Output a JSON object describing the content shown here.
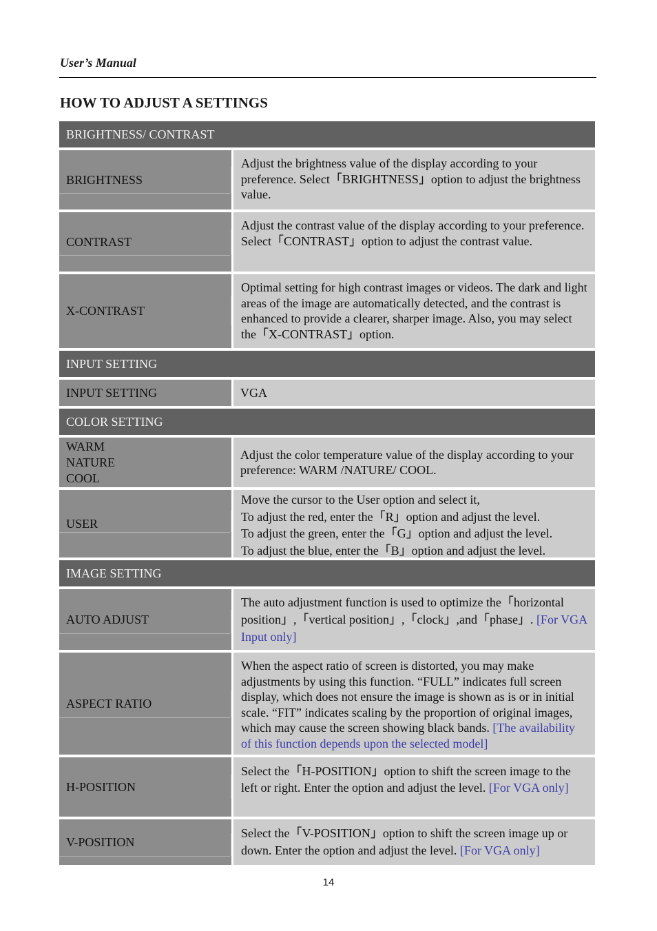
{
  "running_header": "User’s Manual",
  "page_title": "HOW TO ADJUST A SETTINGS",
  "page_number": "14",
  "colors": {
    "section_header_bg": "#616161",
    "label_cell_bg": "#8c8c8c",
    "description_cell_bg": "#cccccc",
    "note_text": "#3c3ca8"
  },
  "sections": [
    {
      "title": "BRIGHTNESS/ CONTRAST",
      "rows": [
        {
          "label": "BRIGHTNESS",
          "description": "Adjust the brightness value of the display according to your preference. Select「BRIGHTNESS」option to adjust the brightness value.",
          "note": ""
        },
        {
          "label": "CONTRAST",
          "description": "Adjust the contrast value of the display according to your preference. Select「CONTRAST」option to adjust the contrast value.",
          "note": ""
        },
        {
          "label": "X-CONTRAST",
          "description": "Optimal setting for high contrast images or videos. The dark and light areas of the image are automatically detected, and the contrast is enhanced to provide a clearer, sharper image. Also, you may select the「X-CONTRAST」option.",
          "note": ""
        }
      ]
    },
    {
      "title": "INPUT SETTING",
      "rows": [
        {
          "label": "INPUT SETTING",
          "description": "VGA",
          "note": ""
        }
      ]
    },
    {
      "title": "COLOR SETTING",
      "rows": [
        {
          "label_lines": [
            "WARM",
            "NATURE",
            "COOL"
          ],
          "description": "Adjust the color temperature value of the display according to your preference: WARM /NATURE/ COOL.",
          "note": ""
        },
        {
          "label": "USER",
          "description_lines": [
            "Move the cursor to the User option and select it,",
            "To adjust the red, enter the「R」option and adjust the level.",
            "To adjust the green, enter the「G」option and adjust the level.",
            "To adjust the blue, enter the「B」option and adjust the level."
          ],
          "note": ""
        }
      ]
    },
    {
      "title": "IMAGE SETTING",
      "rows": [
        {
          "label": "AUTO ADJUST",
          "description": "The auto adjustment function is used to optimize the「horizontal position」,「vertical position」,「clock」,and「phase」. ",
          "note": "[For VGA Input only]"
        },
        {
          "label": "ASPECT RATIO",
          "description": "When the aspect ratio of screen is distorted, you may make adjustments by using this function. “FULL” indicates full screen display, which does not ensure the image is shown as is or in initial scale. “FIT” indicates scaling by the proportion of original images, which may cause the screen showing black bands. ",
          "note": "[The availability of this function depends upon the selected model]"
        },
        {
          "label": "H-POSITION",
          "description": "Select the「H-POSITION」option to shift the screen image to the left or right. Enter the option and adjust the level. ",
          "note": "[For VGA only]"
        },
        {
          "label": "V-POSITION",
          "description": "Select the「V-POSITION」option to shift the screen image up or down. Enter the option and adjust the level. ",
          "note": "[For VGA only]"
        }
      ]
    }
  ]
}
